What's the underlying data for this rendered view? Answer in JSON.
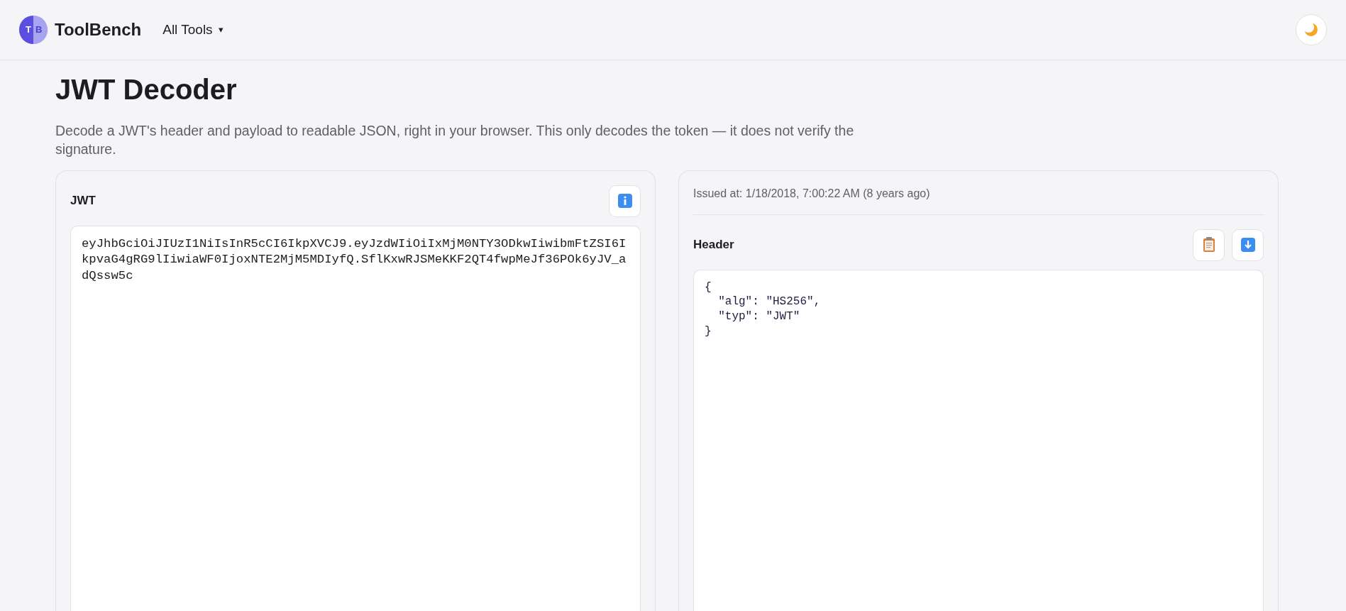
{
  "app": {
    "logo_letters": [
      "T",
      "B"
    ],
    "name": "ToolBench",
    "menu": "All Tools",
    "menu_caret": "▾"
  },
  "page": {
    "title": "JWT Decoder",
    "description": "Decode a JWT's header and payload to readable JSON, right in your browser. This only decodes the token — it does not verify the signature."
  },
  "input_panel": {
    "label": "JWT",
    "token": "eyJhbGciOiJIUzI1NiIsInR5cCI6IkpXVCJ9.eyJzdWIiOiIxMjM0NTY3ODkwIiwibmFtZSI6IkpvaG4gRG9lIiwiaWF0IjoxNTE2MjM5MDIyfQ.SflKxwRJSMeKKF2QT4fwpMeJf36POk6yJV_adQssw5c"
  },
  "output_panel": {
    "issued_at": "Issued at: 1/18/2018, 7:00:22 AM (8 years ago)",
    "section": "Header",
    "header_json": "{\n  \"alg\": \"HS256\",\n  \"typ\": \"JWT\"\n}"
  }
}
